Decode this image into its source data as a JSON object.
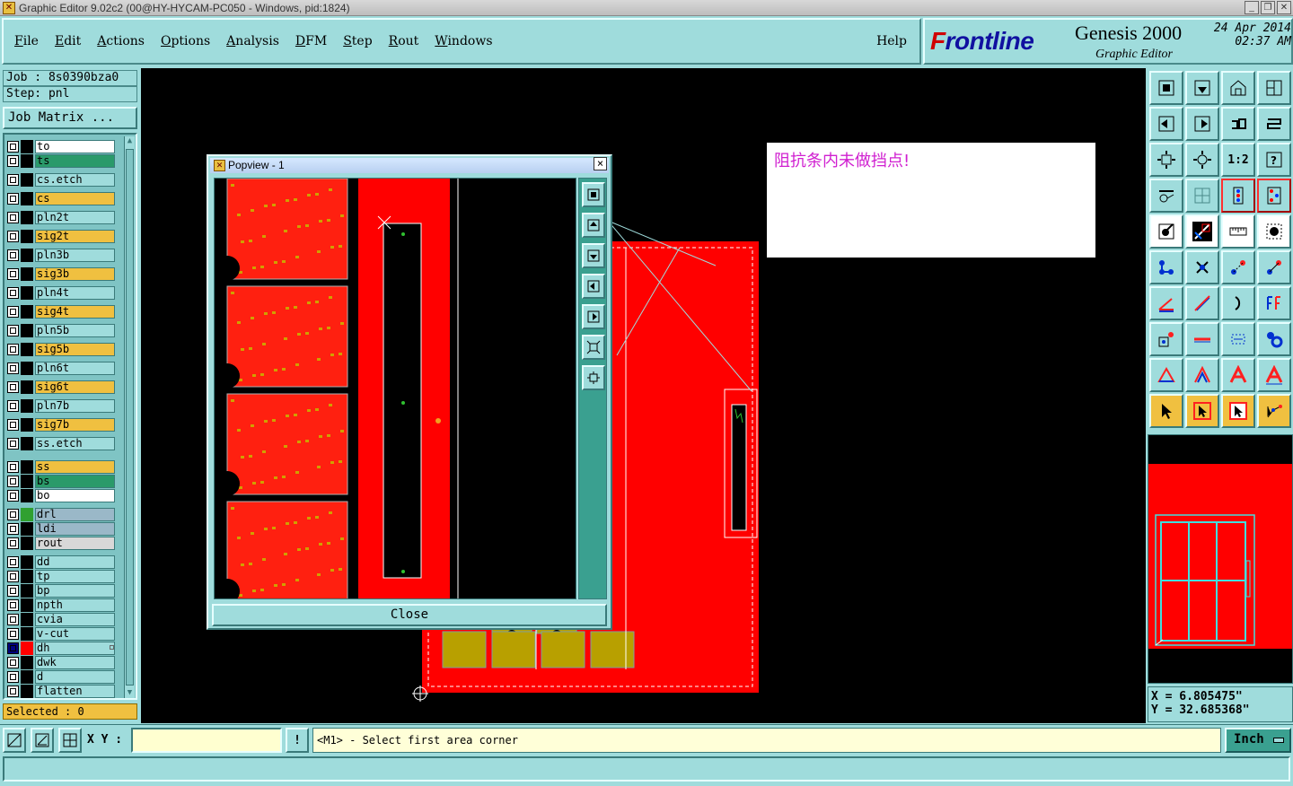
{
  "window": {
    "title": "Graphic Editor 9.02c2 (00@HY-HYCAM-PC050 - Windows, pid:1824)",
    "app_icon": "x-window-icon",
    "controls": [
      "minimize",
      "maximize",
      "close"
    ]
  },
  "menu": {
    "items": [
      "File",
      "Edit",
      "Actions",
      "Options",
      "Analysis",
      "DFM",
      "Step",
      "Rout",
      "Windows"
    ],
    "help": "Help"
  },
  "logo": {
    "brand": "rontline",
    "brand_initial": "F",
    "product": "Genesis 2000",
    "subtitle": "Graphic Editor",
    "date": "24 Apr 2014",
    "time": "02:37 AM"
  },
  "job": {
    "job_line": "Job : 8s0390bza0",
    "step_line": "Step: pnl",
    "matrix_button": "Job Matrix ..."
  },
  "layers": [
    {
      "name": "to",
      "bg": "#ffffff",
      "swatch": "#000000",
      "group": 0
    },
    {
      "name": "ts",
      "bg": "#2a9a6a",
      "swatch": "#000000",
      "group": 0
    },
    {
      "name": "cs.etch",
      "bg": "#9fdcdc",
      "swatch": "#000000",
      "group": 1
    },
    {
      "name": "cs",
      "bg": "#f0c040",
      "swatch": "#000000",
      "group": 1
    },
    {
      "name": "pln2t",
      "bg": "#9fdcdc",
      "swatch": "#000000",
      "group": 1
    },
    {
      "name": "sig2t",
      "bg": "#f0c040",
      "swatch": "#000000",
      "group": 1
    },
    {
      "name": "pln3b",
      "bg": "#9fdcdc",
      "swatch": "#000000",
      "group": 1
    },
    {
      "name": "sig3b",
      "bg": "#f0c040",
      "swatch": "#000000",
      "group": 1
    },
    {
      "name": "pln4t",
      "bg": "#9fdcdc",
      "swatch": "#000000",
      "group": 1
    },
    {
      "name": "sig4t",
      "bg": "#f0c040",
      "swatch": "#000000",
      "group": 1
    },
    {
      "name": "pln5b",
      "bg": "#9fdcdc",
      "swatch": "#000000",
      "group": 1
    },
    {
      "name": "sig5b",
      "bg": "#f0c040",
      "swatch": "#000000",
      "group": 1
    },
    {
      "name": "pln6t",
      "bg": "#9fdcdc",
      "swatch": "#000000",
      "group": 1
    },
    {
      "name": "sig6t",
      "bg": "#f0c040",
      "swatch": "#000000",
      "group": 1
    },
    {
      "name": "pln7b",
      "bg": "#9fdcdc",
      "swatch": "#000000",
      "group": 1
    },
    {
      "name": "sig7b",
      "bg": "#f0c040",
      "swatch": "#000000",
      "group": 1
    },
    {
      "name": "ss.etch",
      "bg": "#9fdcdc",
      "swatch": "#000000",
      "group": 1
    },
    {
      "name": "ss",
      "bg": "#f0c040",
      "swatch": "#000000",
      "group": 2
    },
    {
      "name": "bs",
      "bg": "#2a9a6a",
      "swatch": "#000000",
      "group": 2
    },
    {
      "name": "bo",
      "bg": "#ffffff",
      "swatch": "#000000",
      "group": 2
    },
    {
      "name": "drl",
      "bg": "#9ab8c8",
      "swatch": "#30a030",
      "group": 3
    },
    {
      "name": "ldi",
      "bg": "#9ab8c8",
      "swatch": "#000000",
      "group": 3
    },
    {
      "name": "rout",
      "bg": "#d8d8d8",
      "swatch": "#000000",
      "group": 3
    },
    {
      "name": "dd",
      "bg": "#9fdcdc",
      "swatch": "#000000",
      "group": 4
    },
    {
      "name": "tp",
      "bg": "#9fdcdc",
      "swatch": "#000000",
      "group": 4
    },
    {
      "name": "bp",
      "bg": "#9fdcdc",
      "swatch": "#000000",
      "group": 4
    },
    {
      "name": "npth",
      "bg": "#9fdcdc",
      "swatch": "#000000",
      "group": 4
    },
    {
      "name": "cvia",
      "bg": "#9fdcdc",
      "swatch": "#000000",
      "group": 4
    },
    {
      "name": "v-cut",
      "bg": "#9fdcdc",
      "swatch": "#000000",
      "group": 4
    },
    {
      "name": "dh",
      "bg": "#9fdcdc",
      "swatch": "#ff0000",
      "group": 4,
      "active": true
    },
    {
      "name": "dwk",
      "bg": "#9fdcdc",
      "swatch": "#000000",
      "group": 4
    },
    {
      "name": "d",
      "bg": "#9fdcdc",
      "swatch": "#000000",
      "group": 4
    },
    {
      "name": "flatten",
      "bg": "#9fdcdc",
      "swatch": "#000000",
      "group": 4
    }
  ],
  "selected_text": "Selected : 0",
  "canvas": {
    "note_text": "阻抗条内未做挡点!"
  },
  "popview": {
    "title": "Popview - 1",
    "close_button": "Close",
    "close_icon": "×"
  },
  "coords": {
    "x_line": "X = 6.805475\"",
    "y_line": "Y = 32.685368\""
  },
  "bottom": {
    "xy_label": "X Y :",
    "xy_value": "",
    "prompt": "<M1> - Select first area corner",
    "units": "Inch"
  },
  "colors": {
    "panel": "#9fdcdc",
    "copper": "#ff0000",
    "pad": "#b8a000",
    "highlight": "#f0c040",
    "note_text": "#d020d0"
  }
}
